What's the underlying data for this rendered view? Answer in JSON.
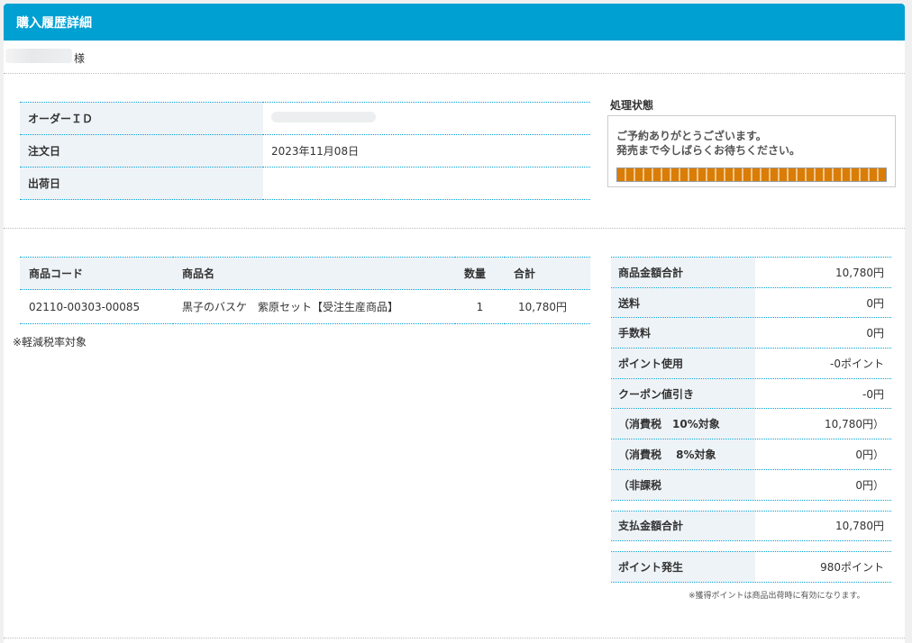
{
  "header": {
    "title": "購入履歴詳細"
  },
  "customer": {
    "suffix": "様"
  },
  "order": {
    "rows": [
      {
        "label": "オーダーＩＤ",
        "value": ""
      },
      {
        "label": "注文日",
        "value": "2023年11月08日"
      },
      {
        "label": "出荷日",
        "value": ""
      }
    ]
  },
  "status": {
    "title": "処理状態",
    "line1": "ご予約ありがとうございます。",
    "line2": "発売まで今しばらくお待ちください。",
    "progress": 1.0,
    "progress_color": "#d97d07"
  },
  "items": {
    "headers": [
      "商品コード",
      "商品名",
      "数量",
      "合計"
    ],
    "rows": [
      {
        "code": "02110-00303-00085",
        "name": "黒子のバスケ　紫原セット【受注生産商品】",
        "qty": "1",
        "total": "10,780円"
      }
    ],
    "note": "※軽減税率対象"
  },
  "summary": {
    "rows": [
      {
        "label": "商品金額合計",
        "value": "10,780円"
      },
      {
        "label": "送料",
        "value": "0円"
      },
      {
        "label": "手数料",
        "value": "0円"
      },
      {
        "label": "ポイント使用",
        "value": "-0ポイント"
      },
      {
        "label": "クーポン値引き",
        "value": "-0円"
      },
      {
        "label": "（消費税　10%対象",
        "value": "10,780円）"
      },
      {
        "label": "（消費税　 8%対象",
        "value": "0円）"
      },
      {
        "label": "（非課税",
        "value": "0円）"
      }
    ],
    "total": {
      "label": "支払金額合計",
      "value": "10,780円"
    },
    "points": {
      "label": "ポイント発生",
      "value": "980ポイント"
    },
    "footnote": "※獲得ポイントは商品出荷時に有効になります。"
  },
  "colors": {
    "accent": "#00a0d2",
    "key_bg": "#eef3f7"
  }
}
